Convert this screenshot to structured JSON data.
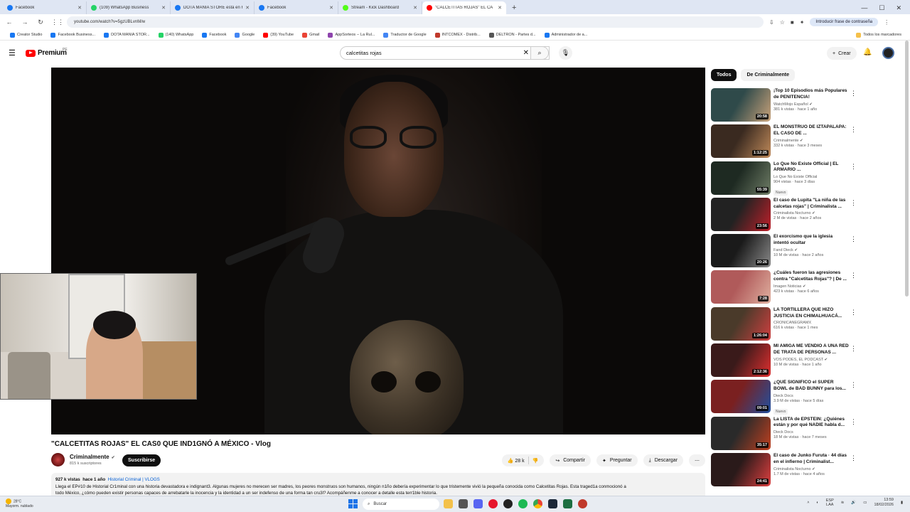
{
  "browser": {
    "tabs": [
      {
        "title": "Facebook",
        "color": "#1877f2"
      },
      {
        "title": "(109) WhatsApp Business",
        "color": "#25d366"
      },
      {
        "title": "DOTA MANIA STORE está en Fa",
        "color": "#1877f2"
      },
      {
        "title": "Facebook",
        "color": "#1877f2"
      },
      {
        "title": "Stream - Kick Dashboard",
        "color": "#53fc18"
      },
      {
        "title": "\"CALCETITAS ROJAS\" EL CA",
        "color": "#ff0000",
        "active": true
      }
    ],
    "url": "youtube.com/watch?v=5gzUBLvnM/w",
    "password_prompt": "Introducir frase de contraseña",
    "bookmarks": [
      {
        "label": "Creator Studio",
        "color": "#1877f2"
      },
      {
        "label": "Facebook Business...",
        "color": "#1877f2"
      },
      {
        "label": "DOTA MANIA STOR...",
        "color": "#1877f2"
      },
      {
        "label": "(140) WhatsApp",
        "color": "#25d366"
      },
      {
        "label": "Facebook",
        "color": "#1877f2"
      },
      {
        "label": "Google",
        "color": "#4285f4"
      },
      {
        "label": "(39) YouTube",
        "color": "#ff0000"
      },
      {
        "label": "Gmail",
        "color": "#ea4335"
      },
      {
        "label": "AppSorteos -- La Rul...",
        "color": "#8e44ad"
      },
      {
        "label": "Traductor de Google",
        "color": "#4285f4"
      },
      {
        "label": "INTCOMEX - Distrib...",
        "color": "#c0392b"
      },
      {
        "label": "DELTRON - Partes d...",
        "color": "#555555"
      },
      {
        "label": "Administrador de a...",
        "color": "#1877f2"
      }
    ],
    "all_bookmarks": "Todos los marcadores"
  },
  "youtube": {
    "logo_text": "Premium",
    "logo_region": "PE",
    "search_value": "calcetitas rojas",
    "create_label": "Crear"
  },
  "video": {
    "title": "\"CALCETITAS ROJAS\" EL CAS0 QUE IND1GNÓ A MÉXICO - Vlog",
    "channel": "Criminalmente",
    "verified": "✔",
    "subscribers": "815 k suscriptores",
    "subscribe_label": "Suscribirse",
    "likes": "28 k",
    "share_label": "Compartir",
    "ask_label": "Preguntar",
    "download_label": "Descargar",
    "views": "927 k vistas",
    "age": "hace 1 año",
    "tags": "Historial Criminal | VLOGS",
    "description_line1": "Llega el EP#10 de Historial Cr1minal con una historia devastadora e indignant3. Algunas mujeres no merecen ser madres, los peores monstruos son humanos, ningún n1ño debería experimentar lo que tristemente vivió la pequeña conocida como Calcetitas Rojas. Esta traged1a conmocionó a",
    "description_line2": "todo México, ¿cómo pueden existir personas capaces de arrebatarle la inocencia y la identidad a un ser indefenso de una forma tan cru3l? Acompáñenme a conocer a detalle esta terr1ble historia."
  },
  "chips": [
    "Todos",
    "De Criminalmente"
  ],
  "recommendations": [
    {
      "title": "¡Top 10 Episodios más Populares de PENITENCIA!",
      "channel": "WatchMojo Español ✔",
      "meta": "381 k vistas · hace 1 año",
      "duration": "20:58",
      "c1": "#2f4a4a",
      "c2": "#c9a27a"
    },
    {
      "title": "EL MONSTRUO DE IZTAPALAPA: EL CASO DE ...",
      "channel": "Criminalmente ✔",
      "meta": "332 k vistas · hace 3 meses",
      "duration": "1:12:25",
      "c1": "#3a2a20",
      "c2": "#c08a5a"
    },
    {
      "title": "Lo Que No Existe Official | EL ARMARIO ...",
      "channel": "Lo Que No Existe Official",
      "meta": "904 vistas · hace 3 días",
      "badge": "Nuevo",
      "duration": "55:39",
      "c1": "#1e2a22",
      "c2": "#6f7d66"
    },
    {
      "title": "El caso de Lupita \"La niña de las calcetas rojas\" | Criminalista ...",
      "channel": "Criminalista Nocturno ✔",
      "meta": "2 M de vistas · hace 2 años",
      "duration": "23:56",
      "c1": "#222222",
      "c2": "#c0202a"
    },
    {
      "title": "El exorcismo que la iglesia intentó ocultar",
      "channel": "Fand Dieck ✔",
      "meta": "10 M de vistas · hace 2 años",
      "duration": "20:26",
      "c1": "#1a1a1a",
      "c2": "#8a8a8a"
    },
    {
      "title": "¿Cuáles fueron las agresiones contra \"Calcetitas Rojas\"? | De ...",
      "channel": "Imagen Noticias ✔",
      "meta": "423 k vistas · hace 6 años",
      "duration": "7:28",
      "c1": "#b05a5a",
      "c2": "#e0b0a0"
    },
    {
      "title": "LA TORTILLERA QUE HIZO JUSTICIA EN CHIMALHUACÁ...",
      "channel": "CRONICANEGRAMX",
      "meta": "616 k vistas · hace 1 mes",
      "duration": "1:26:04",
      "c1": "#4a3a2a",
      "c2": "#d04040"
    },
    {
      "title": "MI AMIGA ME VENDIÓ A UNA RED DE TRATA DE PERSONAS ...",
      "channel": "VOS PODÉS, EL PODCAST ✔",
      "meta": "10 M de vistas · hace 1 año",
      "duration": "2:12:36",
      "c1": "#3a1a1a",
      "c2": "#e03030"
    },
    {
      "title": "¿QUÉ SIGNIFICÓ el SUPER BOWL de BAD BUNNY para los...",
      "channel": "Dieck Docs",
      "meta": "3.9 M de vistas · hace 5 días",
      "badge": "Nuevo",
      "duration": "09:01",
      "c1": "#7a2020",
      "c2": "#2050a0"
    },
    {
      "title": "La LISTA de EPSTEIN: ¿Quiénes están y por qué NADIE habla d...",
      "channel": "Dieck Docs",
      "meta": "18 M de vistas · hace 7 meses",
      "duration": "35:17",
      "c1": "#2a2a2a",
      "c2": "#c04020"
    },
    {
      "title": "El caso de Junko Furuta · 44 días en el infierno | Criminalist...",
      "channel": "Criminalista Nocturno ✔",
      "meta": "1.7 M de vistas · hace 4 años",
      "duration": "24:41",
      "c1": "#2a1a1a",
      "c2": "#e04040"
    }
  ],
  "taskbar": {
    "temperature": "28°C",
    "weather": "Mayorm. nublado",
    "search_label": "Buscar",
    "lang": "ESP",
    "lang2": "LAA",
    "time": "13:59",
    "date": "18/02/2026"
  }
}
